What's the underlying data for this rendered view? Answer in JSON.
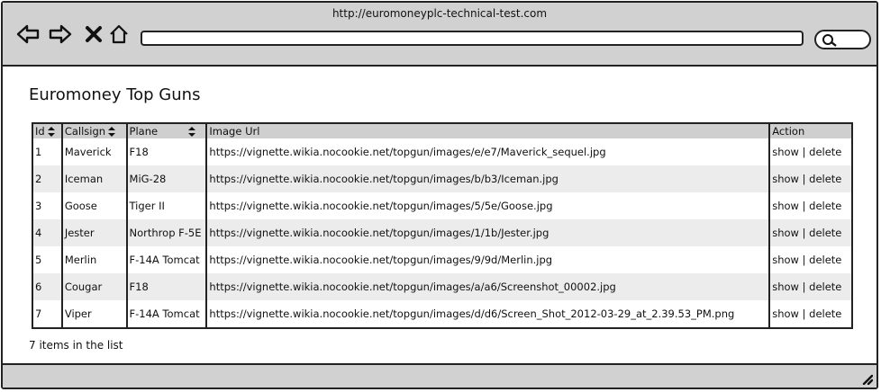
{
  "browser": {
    "url": "http://euromoneyplc-technical-test.com",
    "nav_icons": [
      "back-arrow-icon",
      "forward-arrow-icon",
      "close-x-icon",
      "home-icon"
    ],
    "search_icon": "search-icon"
  },
  "page": {
    "title": "Euromoney Top Guns",
    "count_text": "7 items in the list"
  },
  "table": {
    "headers": {
      "id": "Id",
      "callsign": "Callsign",
      "plane": "Plane",
      "image_url": "Image Url",
      "action": "Action"
    },
    "rows": [
      {
        "id": "1",
        "callsign": "Maverick",
        "plane": "F18",
        "image_url": "https://vignette.wikia.nocookie.net/topgun/images/e/e7/Maverick_sequel.jpg",
        "show": "show",
        "sep": "|",
        "delete": "delete"
      },
      {
        "id": "2",
        "callsign": "Iceman",
        "plane": "MiG-28",
        "image_url": "https://vignette.wikia.nocookie.net/topgun/images/b/b3/Iceman.jpg",
        "show": "show",
        "sep": "|",
        "delete": "delete"
      },
      {
        "id": "3",
        "callsign": "Goose",
        "plane": "Tiger II",
        "image_url": "https://vignette.wikia.nocookie.net/topgun/images/5/5e/Goose.jpg",
        "show": "show",
        "sep": "|",
        "delete": "delete"
      },
      {
        "id": "4",
        "callsign": "Jester",
        "plane": "Northrop F-5E",
        "image_url": "https://vignette.wikia.nocookie.net/topgun/images/1/1b/Jester.jpg",
        "show": "show",
        "sep": "|",
        "delete": "delete"
      },
      {
        "id": "5",
        "callsign": "Merlin",
        "plane": "F-14A Tomcat",
        "image_url": "https://vignette.wikia.nocookie.net/topgun/images/9/9d/Merlin.jpg",
        "show": "show",
        "sep": "|",
        "delete": "delete"
      },
      {
        "id": "6",
        "callsign": "Cougar",
        "plane": "F18",
        "image_url": "https://vignette.wikia.nocookie.net/topgun/images/a/a6/Screenshot_00002.jpg",
        "show": "show",
        "sep": "|",
        "delete": "delete"
      },
      {
        "id": "7",
        "callsign": "Viper",
        "plane": "F-14A Tomcat",
        "image_url": "https://vignette.wikia.nocookie.net/topgun/images/d/d6/Screen_Shot_2012-03-29_at_2.39.53_PM.png",
        "show": "show",
        "sep": "|",
        "delete": "delete"
      }
    ]
  }
}
